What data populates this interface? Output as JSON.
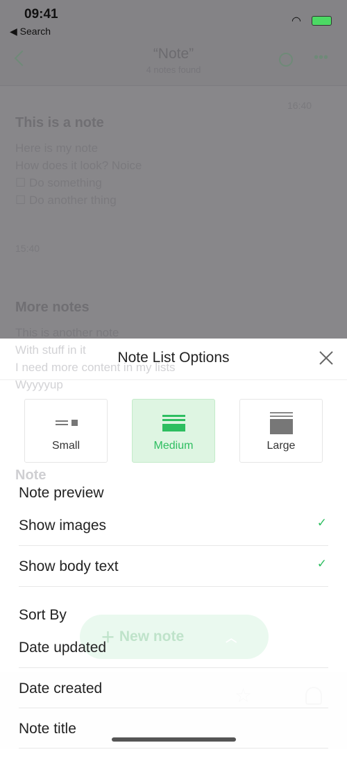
{
  "status_bar": {
    "time": "09:41",
    "back_app": "◀ Search",
    "battery_color": "#4cd964"
  },
  "nav": {
    "title": "“Note”",
    "subtitle": "4 notes found"
  },
  "background_notes": [
    {
      "date": "16:40",
      "title": "This is a note",
      "lines": [
        "Here is my note",
        "How does it look? Noice"
      ],
      "checklist": [
        "Do something",
        "Do another thing"
      ],
      "time": "15:40"
    },
    {
      "title": "More notes",
      "lines": [
        "This is another note",
        "With stuff in it",
        "I need more content in my lists",
        "Wyyyyup"
      ]
    },
    {
      "title": "Note"
    }
  ],
  "new_note_button": {
    "label": "New note",
    "color": "#2dbe60"
  },
  "sheet": {
    "title": "Note List Options",
    "sizes": [
      {
        "label": "Small",
        "selected": false
      },
      {
        "label": "Medium",
        "selected": true
      },
      {
        "label": "Large",
        "selected": false
      }
    ],
    "preview_heading": "Note preview",
    "preview_options": [
      {
        "label": "Show images",
        "checked": true
      },
      {
        "label": "Show body text",
        "checked": true
      }
    ],
    "sort_heading": "Sort By",
    "sort_options": [
      {
        "label": "Date updated"
      },
      {
        "label": "Date created"
      },
      {
        "label": "Note title"
      }
    ],
    "accent": "#2dbe60"
  }
}
